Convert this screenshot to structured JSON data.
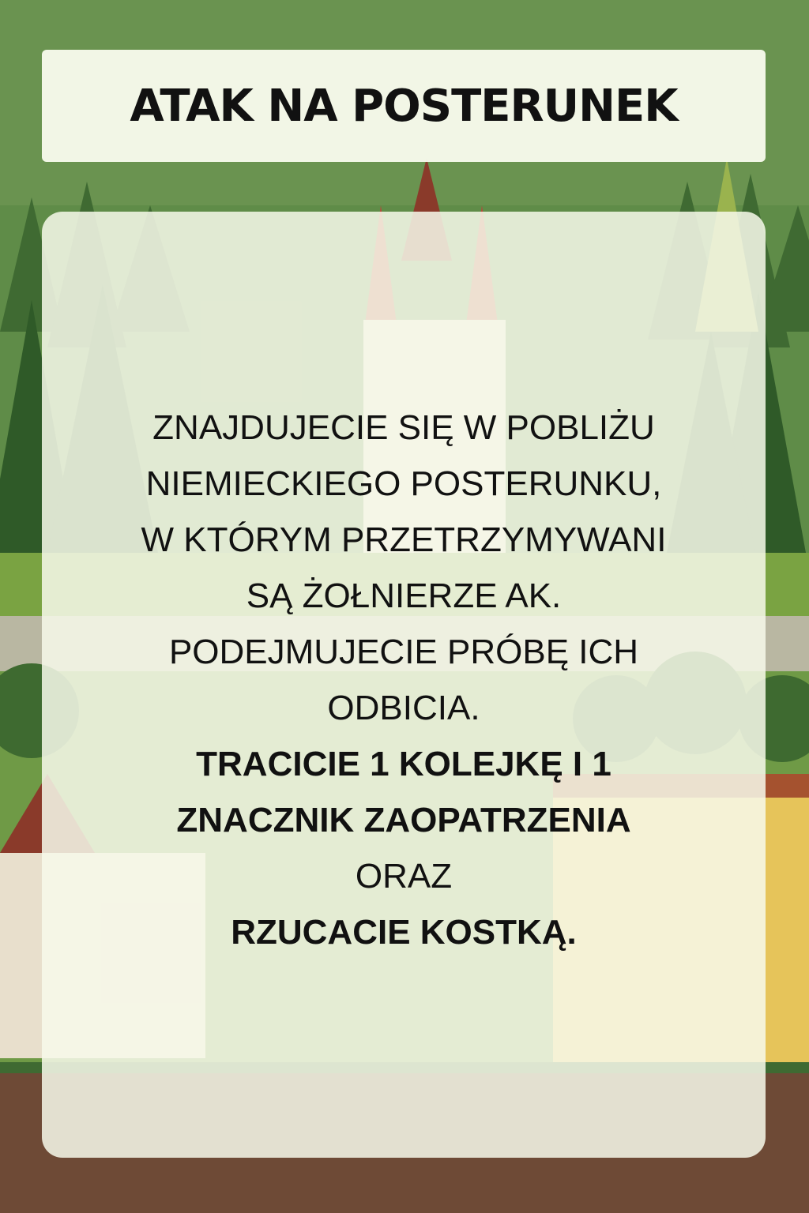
{
  "card": {
    "title": "ATAK NA POSTERUNEK",
    "lines": [
      "ZNAJDUJECIE SIĘ W POBLIŻU",
      "NIEMIECKIEGO POSTERUNKU,",
      "W KTÓRYM PRZETRZYMYWANI",
      "SĄ ŻOŁNIERZE AK.",
      "PODEJMUJECIE PRÓBĘ ICH",
      "ODBICIA.",
      "TRACICIE 1 KOLEJKĘ I 1",
      "ZNACZNIK ZAOPATRZENIA",
      "ORAZ",
      "RZUCACIE KOSTKĄ."
    ]
  },
  "colors": {
    "forest": "#4f7a3d",
    "sky": "#6a9350",
    "panel": "#f7f9ea",
    "text": "#111111",
    "roof": "#8a3a2a",
    "wall": "#e6c45a",
    "ground": "#6e4a36"
  }
}
